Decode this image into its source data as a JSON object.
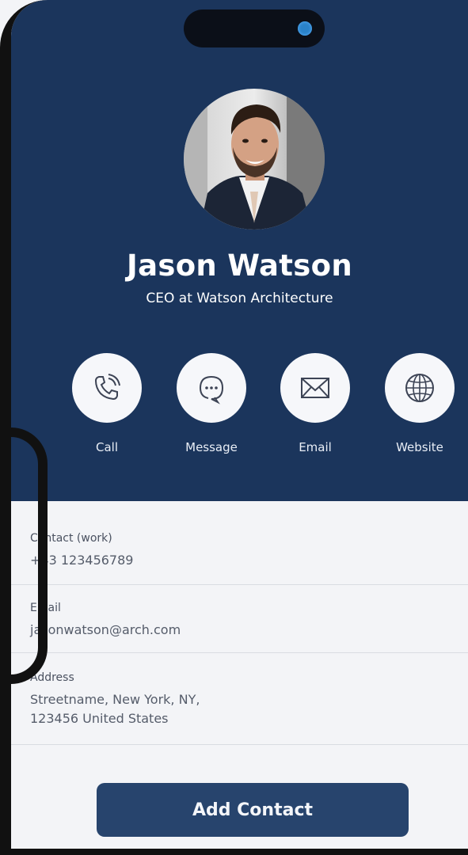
{
  "profile": {
    "name": "Jason Watson",
    "title": "CEO at Watson Architecture"
  },
  "actions": [
    {
      "label": "Call",
      "icon": "phone-icon"
    },
    {
      "label": "Message",
      "icon": "message-icon"
    },
    {
      "label": "Email",
      "icon": "envelope-icon"
    },
    {
      "label": "Website",
      "icon": "globe-icon"
    }
  ],
  "details": {
    "contact_label": "Contact (work)",
    "contact_value": "+43 123456789",
    "email_label": "Email",
    "email_value": "jasonwatson@arch.com",
    "address_label": "Address",
    "address_line1": "Streetname, New York, NY,",
    "address_line2": "123456 United States"
  },
  "button": {
    "add_contact": "Add Contact"
  },
  "colors": {
    "header": "#1b355c",
    "button": "#27446d",
    "background": "#f3f4f7"
  }
}
